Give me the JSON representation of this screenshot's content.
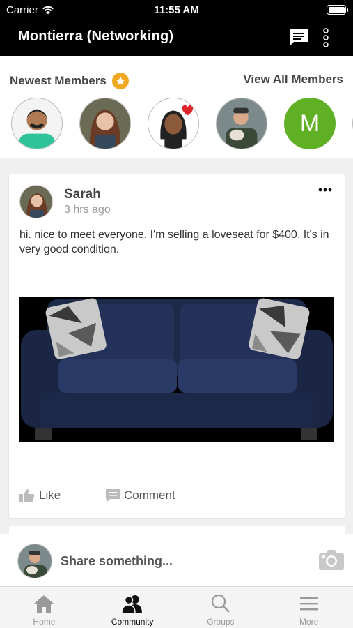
{
  "status_bar": {
    "carrier": "Carrier",
    "time": "11:55 AM"
  },
  "header": {
    "title": "Montierra (Networking)",
    "chat_icon": "chat-icon",
    "more_icon": "vertical-dots-icon"
  },
  "members": {
    "title": "Newest Members",
    "badge_icon": "star-icon",
    "view_all": "View All Members",
    "letter_avatar": "M",
    "letter_avatar_color": "#5fb024"
  },
  "post": {
    "author": "Sarah",
    "time": "3 hrs ago",
    "text": "hi. nice to meet everyone.  I'm selling a loveseat for $400. It's in very good condition.",
    "like_label": "Like",
    "comment_label": "Comment"
  },
  "composer": {
    "prompt": "Share something...",
    "camera_icon": "camera-icon"
  },
  "tabs": [
    {
      "label": "Home",
      "icon": "home-icon",
      "active": false
    },
    {
      "label": "Community",
      "icon": "community-icon",
      "active": true
    },
    {
      "label": "Groups",
      "icon": "search-icon",
      "active": false
    },
    {
      "label": "More",
      "icon": "menu-icon",
      "active": false
    }
  ],
  "colors": {
    "header_bg": "#000000",
    "star": "#f0a820",
    "sofa": "#1e2a4a"
  }
}
